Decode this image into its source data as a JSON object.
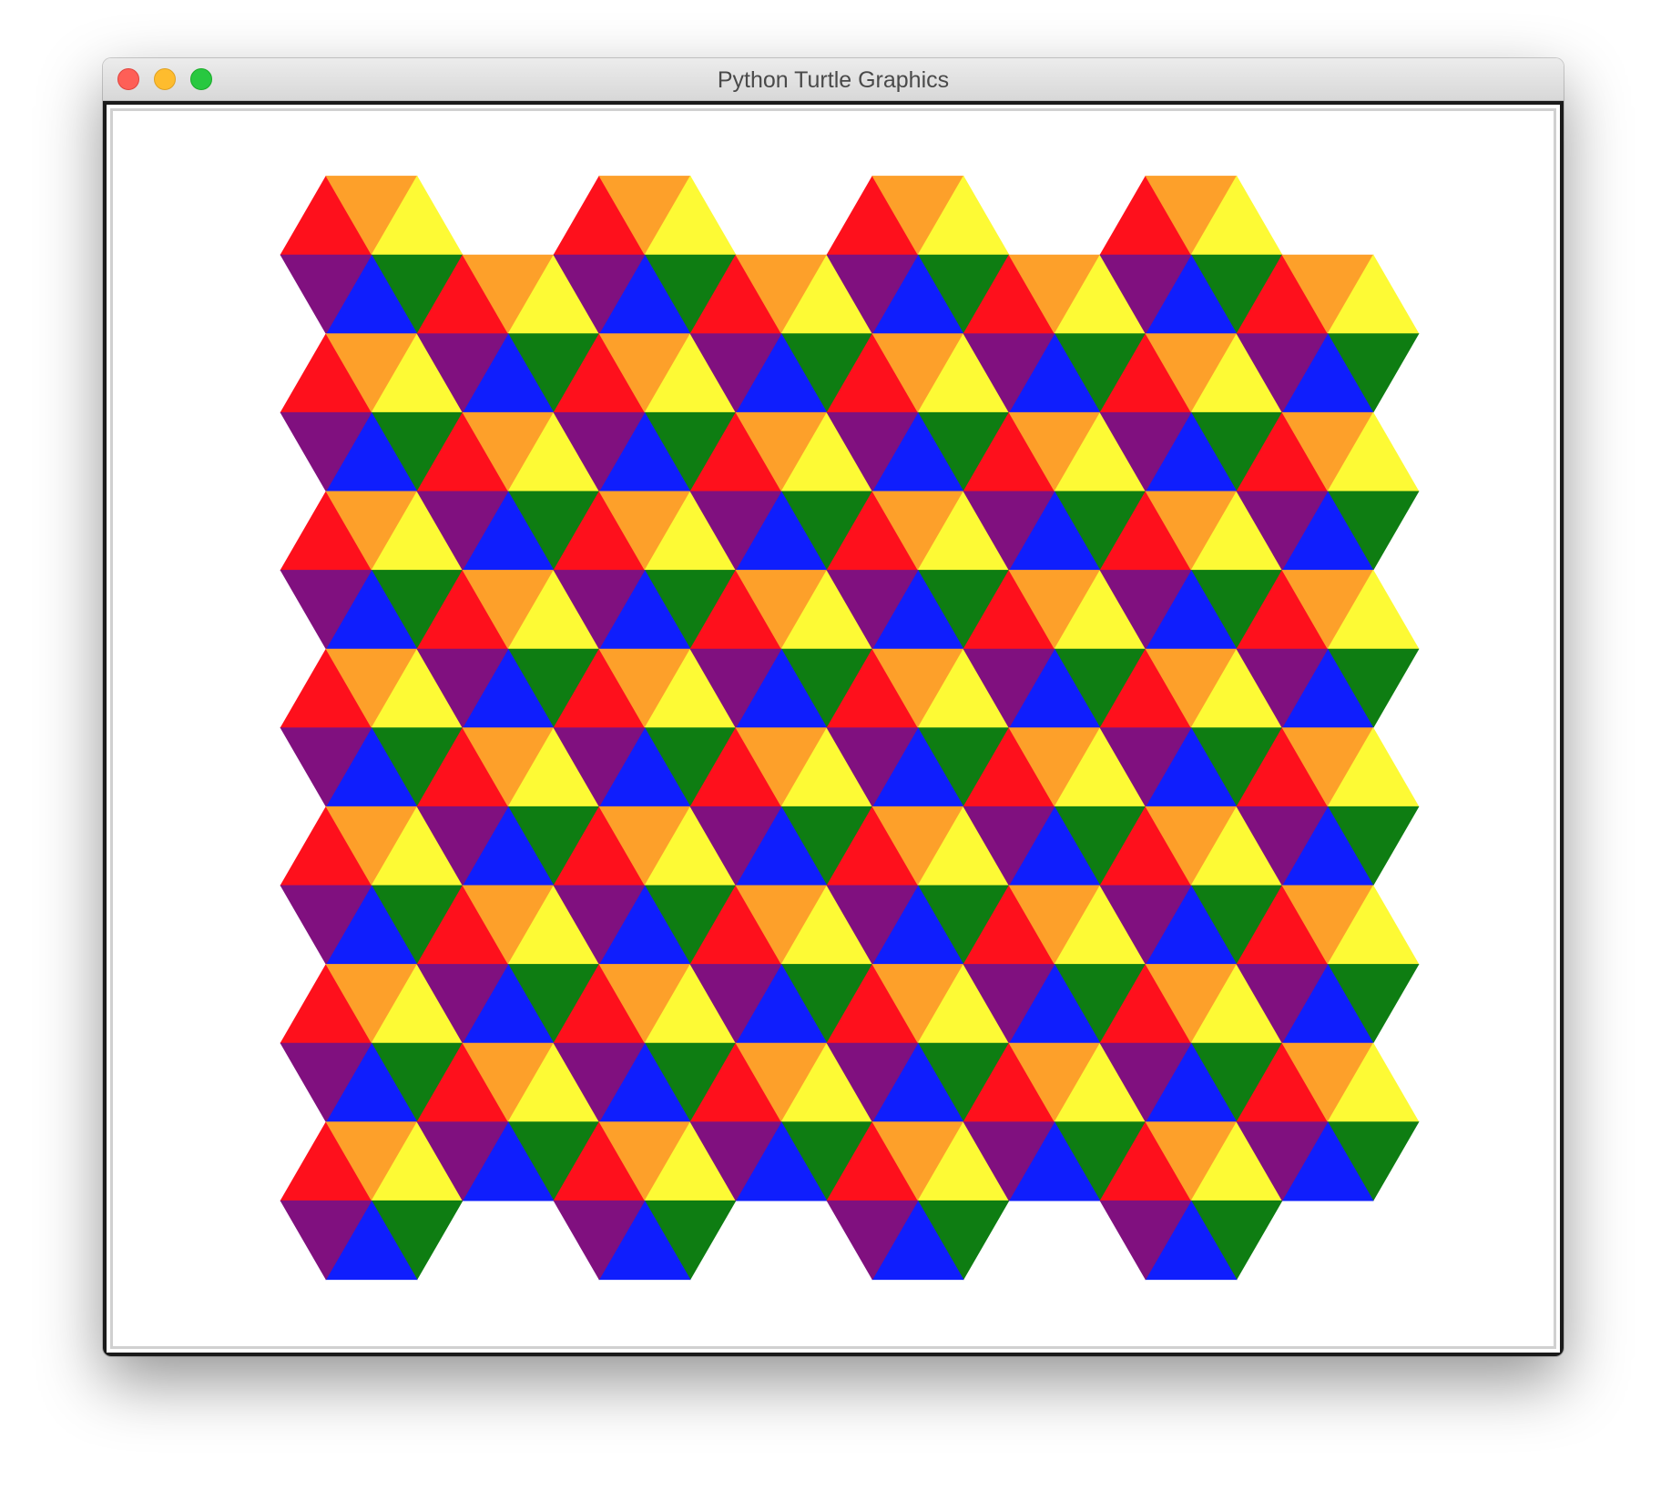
{
  "window": {
    "title": "Python Turtle Graphics"
  },
  "palette": {
    "red": "#fe101c",
    "orange": "#fda02a",
    "yellow": "#fdfa35",
    "purple": "#80107f",
    "blue": "#0f1efd",
    "green": "#0e7d12"
  },
  "icons": [
    "close-icon",
    "minimize-icon",
    "maximize-icon"
  ]
}
